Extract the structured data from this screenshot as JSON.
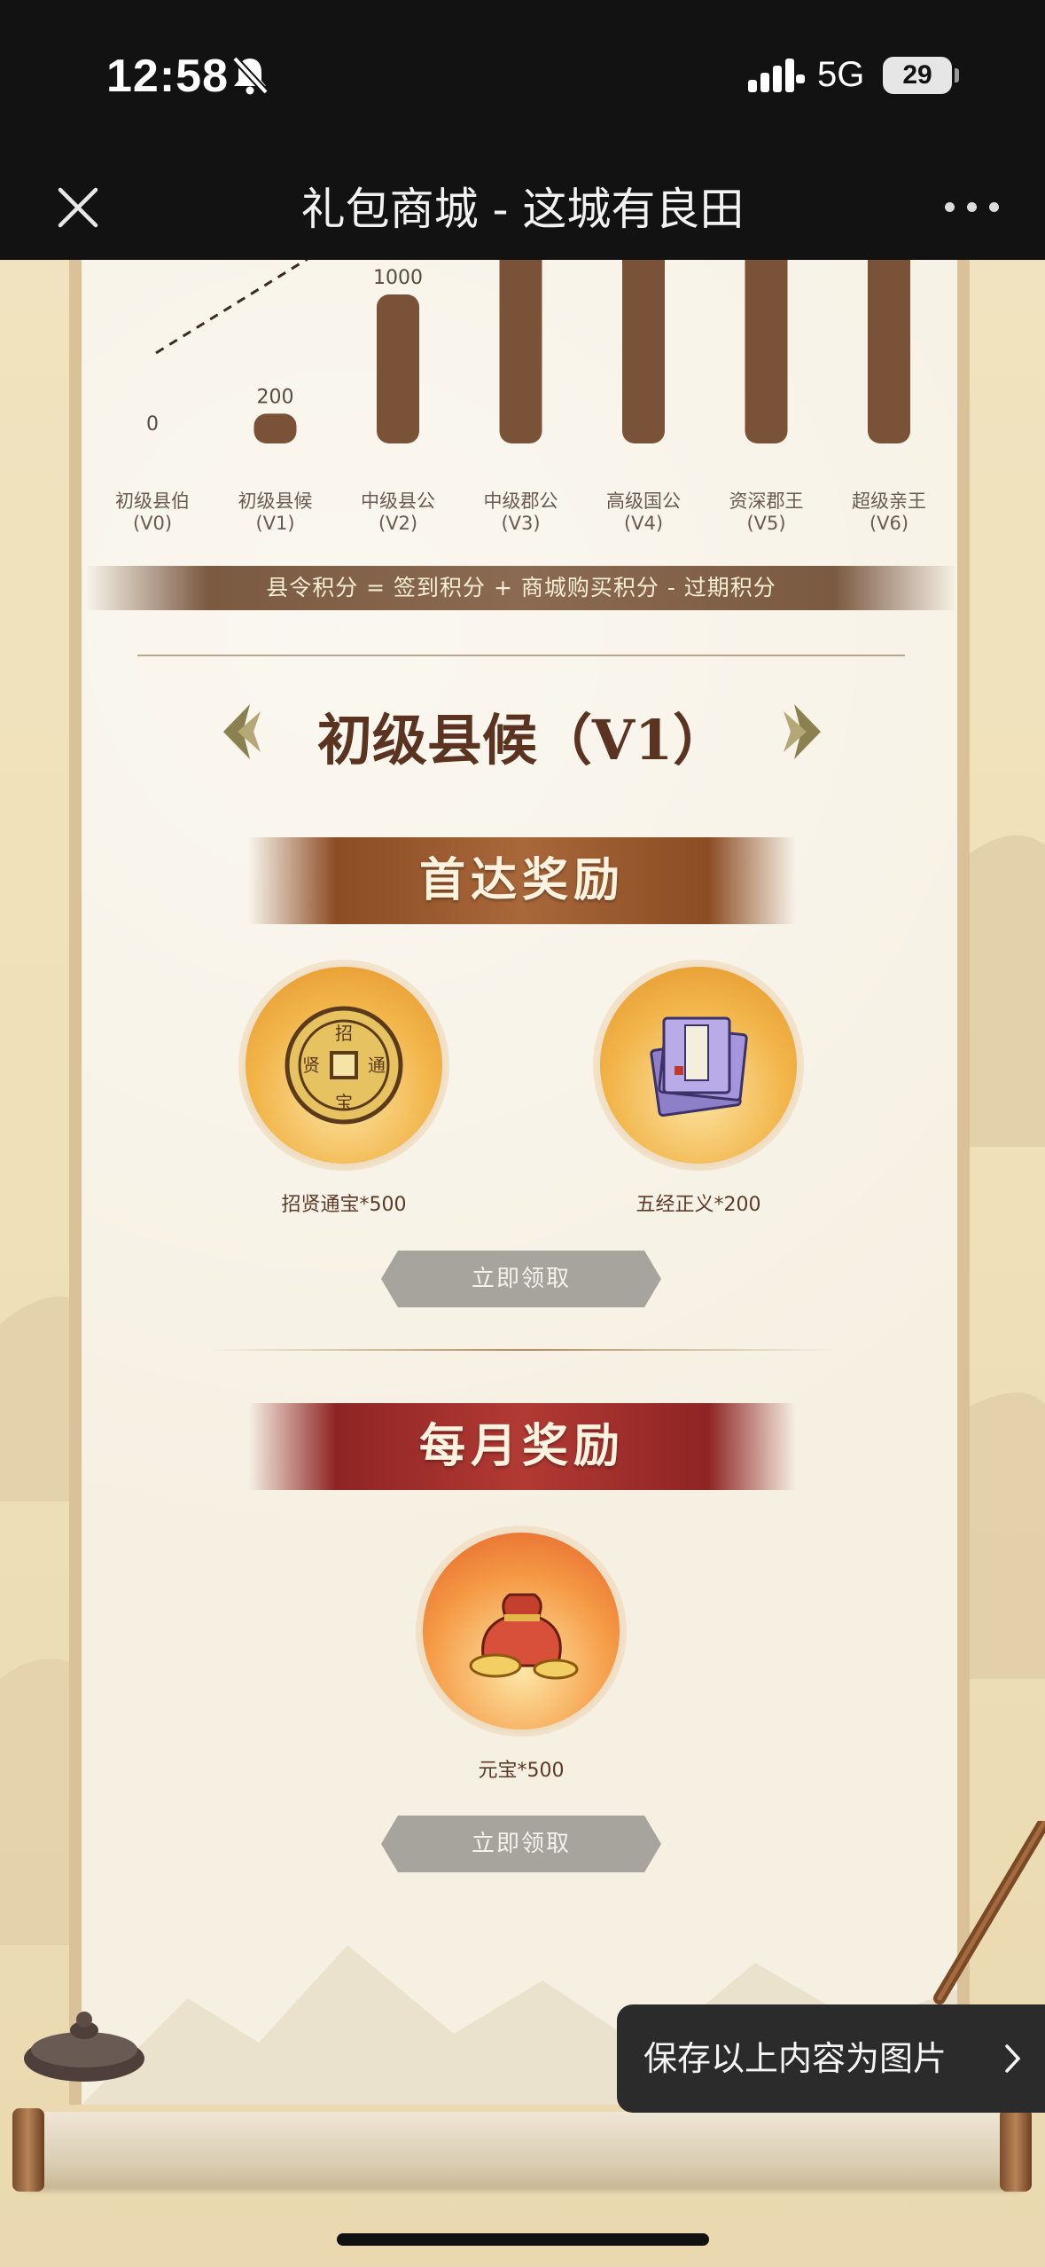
{
  "status_bar": {
    "time": "12:58",
    "network": "5G",
    "battery": "29"
  },
  "header": {
    "title": "礼包商城 - 这城有良田"
  },
  "chart_data": {
    "type": "bar",
    "categories": [
      "初级县伯",
      "初级县候",
      "中级县公",
      "中级郡公",
      "高级国公",
      "资深郡王",
      "超级亲王"
    ],
    "level_codes": [
      "(V0)",
      "(V1)",
      "(V2)",
      "(V3)",
      "(V4)",
      "(V5)",
      "(V6)"
    ],
    "values": [
      0,
      200,
      1000,
      null,
      null,
      null,
      null
    ],
    "value_labels": [
      "0",
      "200",
      "1000",
      "",
      "",
      "",
      ""
    ]
  },
  "formula": "县令积分 = 签到积分 + 商城购买积分 - 过期积分",
  "level": {
    "title": "初级县候（V1）"
  },
  "first_reward": {
    "banner": "首达奖励",
    "items": [
      {
        "label": "招贤通宝*500",
        "icon": "coin-icon"
      },
      {
        "label": "五经正义*200",
        "icon": "books-icon"
      }
    ],
    "claim_label": "立即领取"
  },
  "monthly_reward": {
    "banner": "每月奖励",
    "items": [
      {
        "label": "元宝*500",
        "icon": "ingot-bag-icon"
      }
    ],
    "claim_label": "立即领取"
  },
  "toast": {
    "label": "保存以上内容为图片"
  },
  "colors": {
    "bar": "#7a5238",
    "title": "#5b3321",
    "banner_first": "#a8683a",
    "banner_monthly": "#b23a34"
  }
}
